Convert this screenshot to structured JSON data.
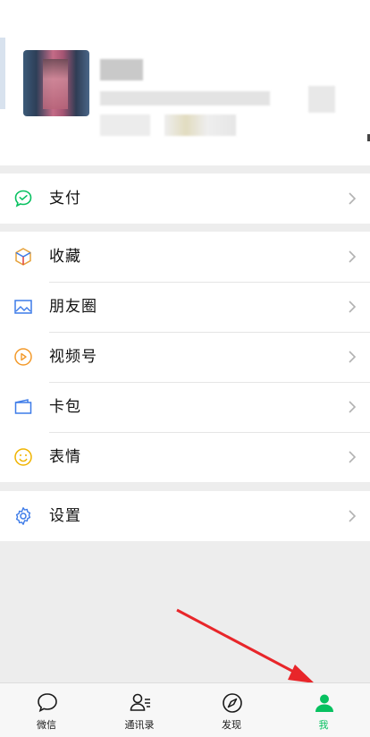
{
  "menu": {
    "pay": "支付",
    "favorites": "收藏",
    "moments": "朋友圈",
    "channels": "视频号",
    "cards": "卡包",
    "stickers": "表情",
    "settings": "设置"
  },
  "tabs": [
    {
      "label": "微信",
      "icon": "chat-bubble-icon"
    },
    {
      "label": "通讯录",
      "icon": "contacts-icon"
    },
    {
      "label": "发现",
      "icon": "compass-icon"
    },
    {
      "label": "我",
      "icon": "person-icon",
      "active": true
    }
  ],
  "colors": {
    "accent": "#07c160",
    "arrow": "#e8262a",
    "background": "#ededed"
  }
}
